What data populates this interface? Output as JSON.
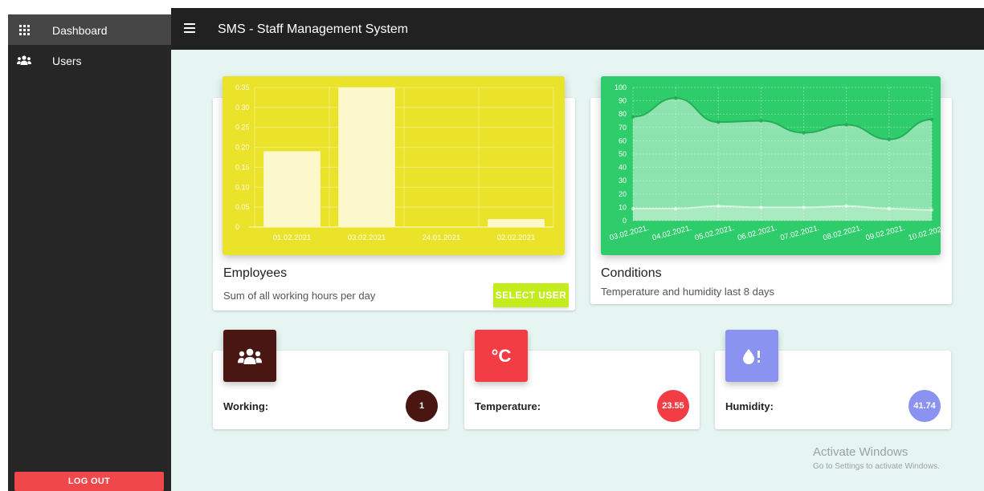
{
  "sidebar": {
    "items": [
      {
        "label": "Dashboard",
        "icon": "grid-icon"
      },
      {
        "label": "Users",
        "icon": "users-icon"
      }
    ],
    "logout_label": "LOG OUT"
  },
  "header": {
    "title": "SMS - Staff Management System",
    "menu_icon": "hamburger-icon"
  },
  "employees": {
    "title": "Employees",
    "subtitle": "Sum of all working hours per day",
    "button_label": "SELECT USER",
    "color": "#ebe32a"
  },
  "conditions": {
    "title": "Conditions",
    "subtitle": "Temperature and humidity last 8 days",
    "color": "#2ecc6b"
  },
  "stats": [
    {
      "label": "Working:",
      "value": "1",
      "icon": "users-icon",
      "color": "#4a1612"
    },
    {
      "label": "Temperature:",
      "value": "23.55",
      "icon": "celsius-icon",
      "icon_text": "°C",
      "color": "#f23d45"
    },
    {
      "label": "Humidity:",
      "value": "41.74",
      "icon": "droplet-alert-icon",
      "color": "#8a93ef"
    }
  ],
  "watermark": {
    "line1": "Activate Windows",
    "line2": "Go to Settings to activate Windows."
  },
  "chart_data": [
    {
      "type": "bar",
      "categories": [
        "01.02.2021",
        "03.02.2021",
        "24.01.2021",
        "02.02.2021"
      ],
      "values": [
        0.19,
        0.35,
        0,
        0.02
      ],
      "ylim": [
        0,
        0.35
      ],
      "yticks": [
        "0",
        "0.05",
        "0.10",
        "0.15",
        "0.20",
        "0.25",
        "0.30",
        "0.35"
      ],
      "grid": true
    },
    {
      "type": "area",
      "categories": [
        "03.02.2021.",
        "04.02.2021.",
        "05.02.2021.",
        "06.02.2021.",
        "07.02.2021.",
        "08.02.2021.",
        "09.02.2021.",
        "10.02.2021."
      ],
      "series": [
        {
          "values": [
            78,
            92,
            74,
            75,
            66,
            72,
            61,
            76
          ]
        },
        {
          "values": [
            9,
            9,
            11,
            10,
            10,
            11,
            9,
            8
          ]
        }
      ],
      "ylim": [
        0,
        100
      ],
      "yticks": [
        "0",
        "10",
        "20",
        "30",
        "40",
        "50",
        "60",
        "70",
        "80",
        "90",
        "100"
      ],
      "grid": true
    }
  ]
}
